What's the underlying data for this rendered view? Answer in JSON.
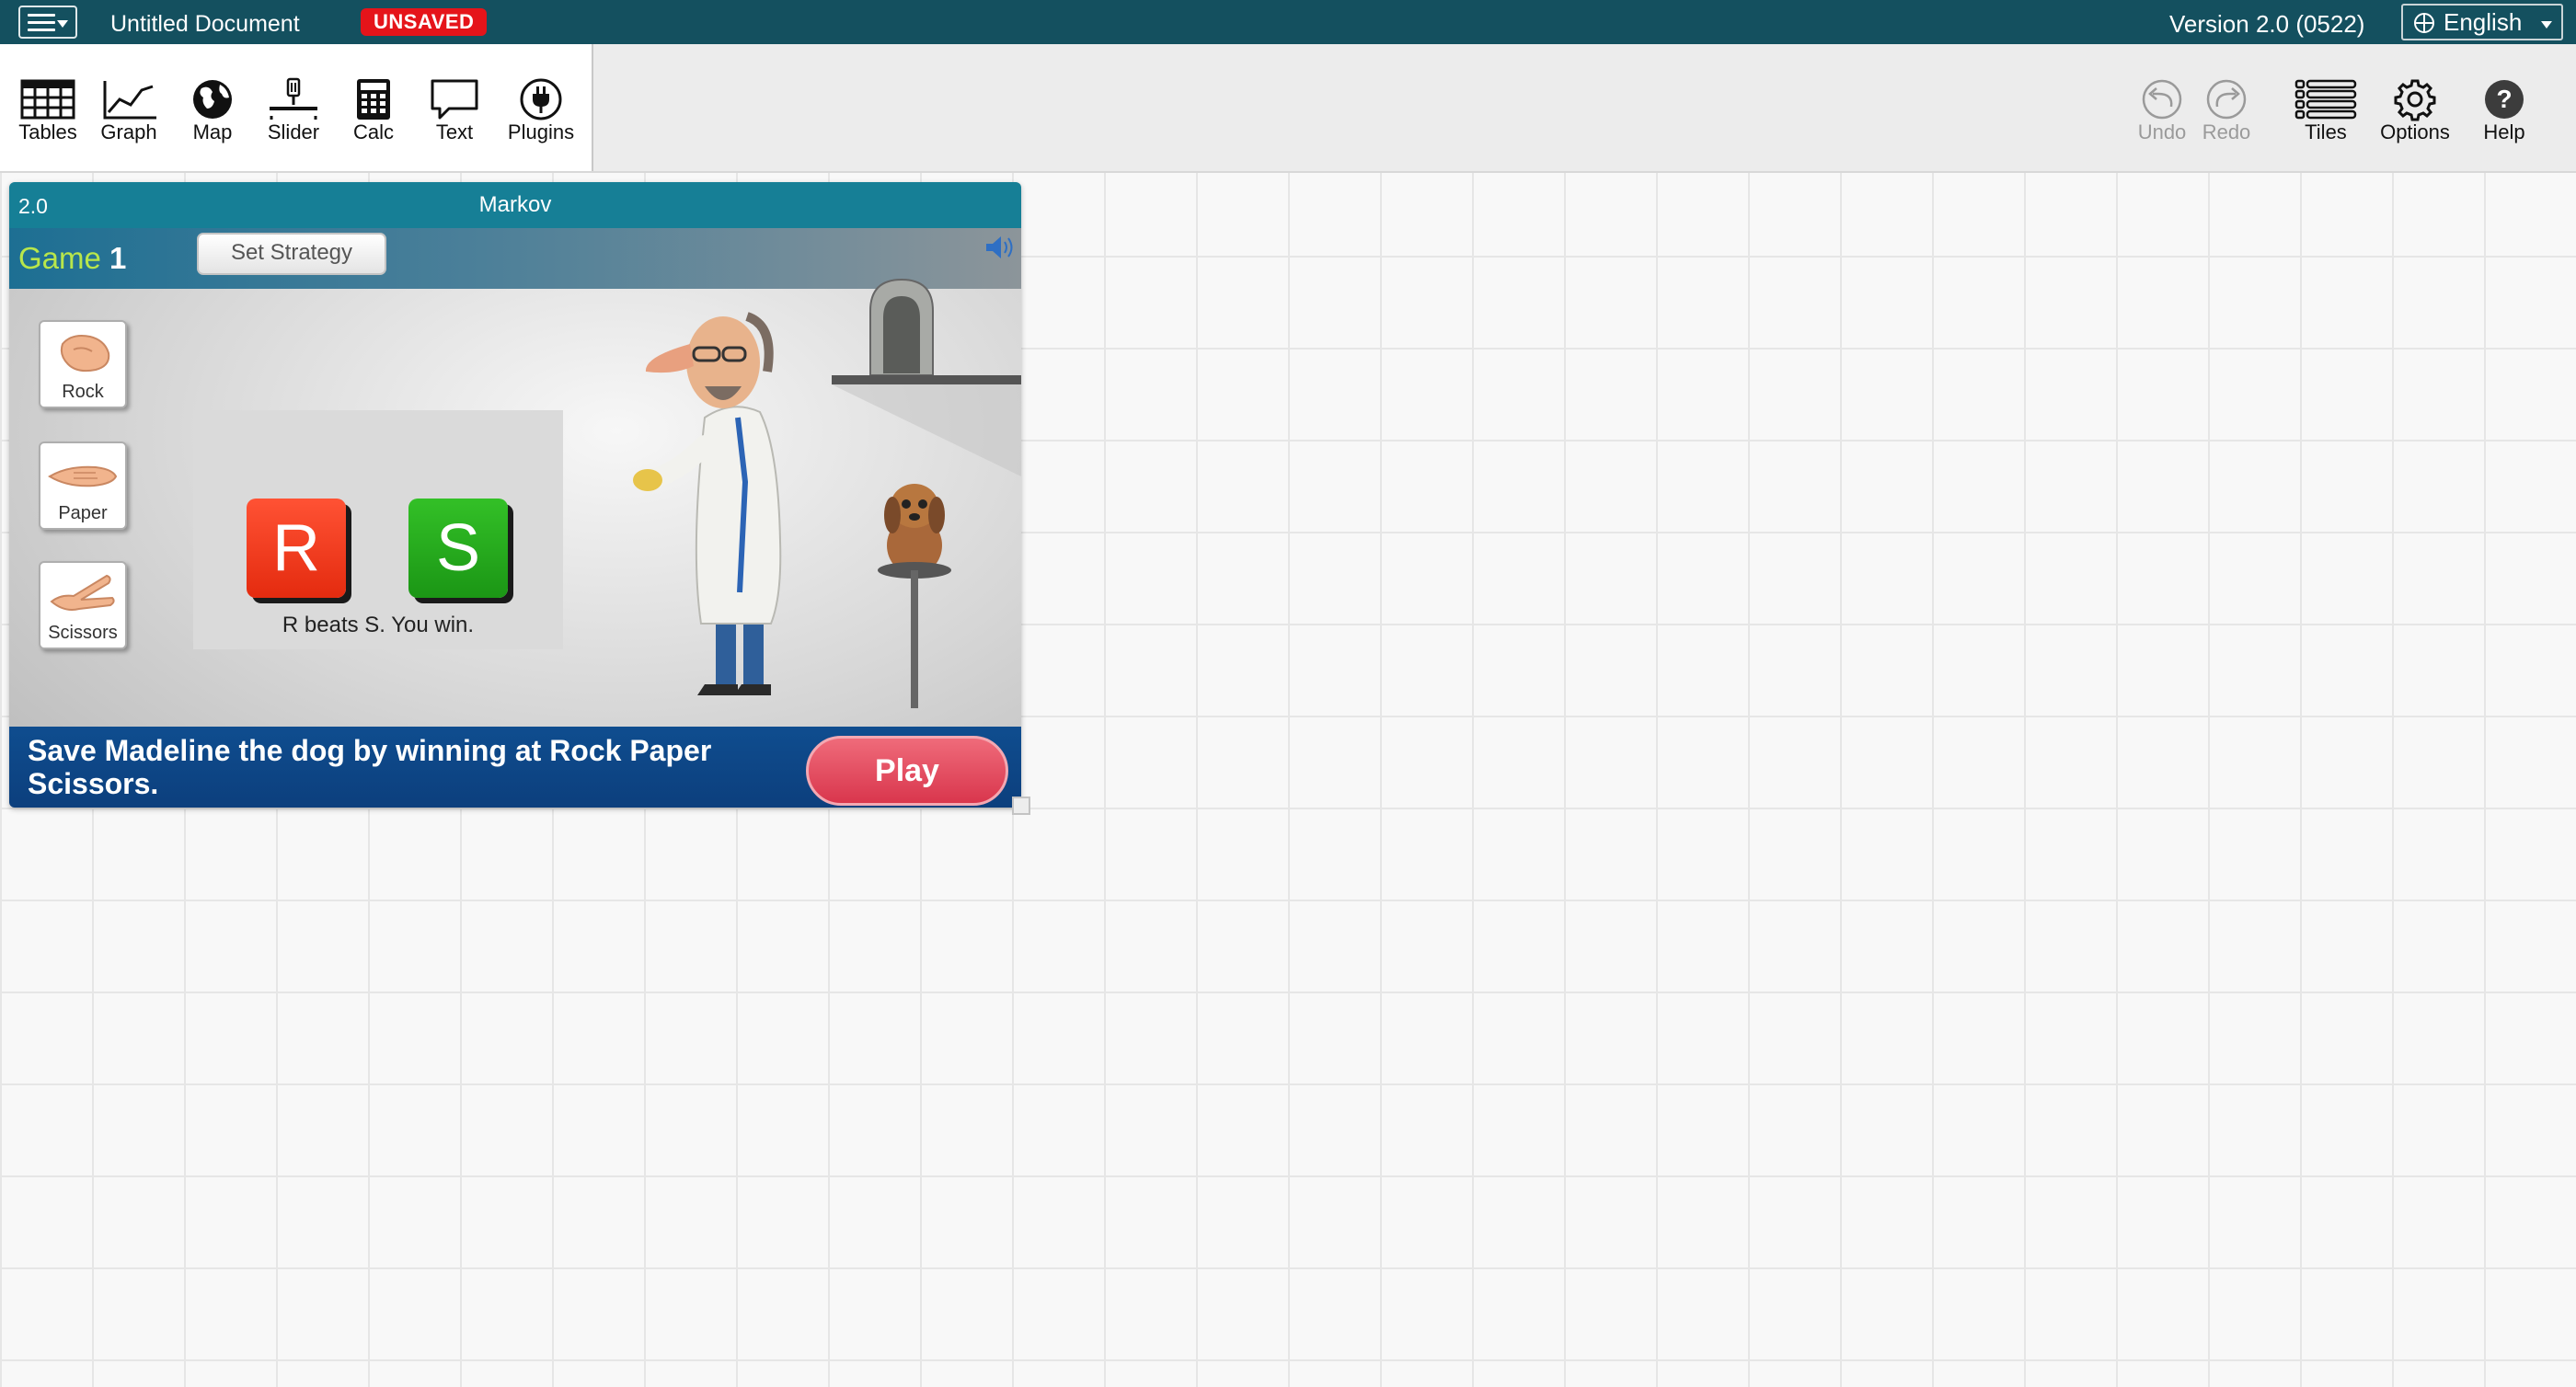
{
  "header": {
    "document_title": "Untitled Document",
    "unsaved_badge": "UNSAVED",
    "version": "Version 2.0 (0522)",
    "language": "English"
  },
  "toolshelf": {
    "left_tools": [
      {
        "label": "Tables",
        "icon": "table-icon"
      },
      {
        "label": "Graph",
        "icon": "graph-icon"
      },
      {
        "label": "Map",
        "icon": "globe-icon"
      },
      {
        "label": "Slider",
        "icon": "slider-icon"
      },
      {
        "label": "Calc",
        "icon": "calculator-icon"
      },
      {
        "label": "Text",
        "icon": "speech-bubble-icon"
      },
      {
        "label": "Plugins",
        "icon": "plug-icon"
      }
    ],
    "right_tools": [
      {
        "label": "Undo",
        "icon": "undo-icon",
        "enabled": false
      },
      {
        "label": "Redo",
        "icon": "redo-icon",
        "enabled": false
      },
      {
        "label": "Tiles",
        "icon": "tiles-list-icon",
        "enabled": true
      },
      {
        "label": "Options",
        "icon": "gear-icon",
        "enabled": true
      },
      {
        "label": "Help",
        "icon": "help-icon",
        "enabled": true
      }
    ]
  },
  "tile": {
    "version": "2.0",
    "title": "Markov",
    "game": {
      "game_label": "Game",
      "game_number": "1",
      "set_strategy_label": "Set Strategy",
      "choices": [
        "Rock",
        "Paper",
        "Scissors"
      ],
      "player_move": "R",
      "opponent_move": "S",
      "result_text": "R beats S. You win.",
      "prompt": "Save Madeline the dog by winning at Rock Paper Scissors.",
      "play_label": "Play"
    }
  },
  "colors": {
    "header_bg": "#14505f",
    "unsaved_badge": "#e5141a",
    "tile_title_bg": "#167f96",
    "footer_bg": "#0f4d8f",
    "play_button": "#d9364d",
    "rock_block": "#e42b0f",
    "scissors_block": "#1b9615",
    "game_label_green": "#b8e64b"
  }
}
